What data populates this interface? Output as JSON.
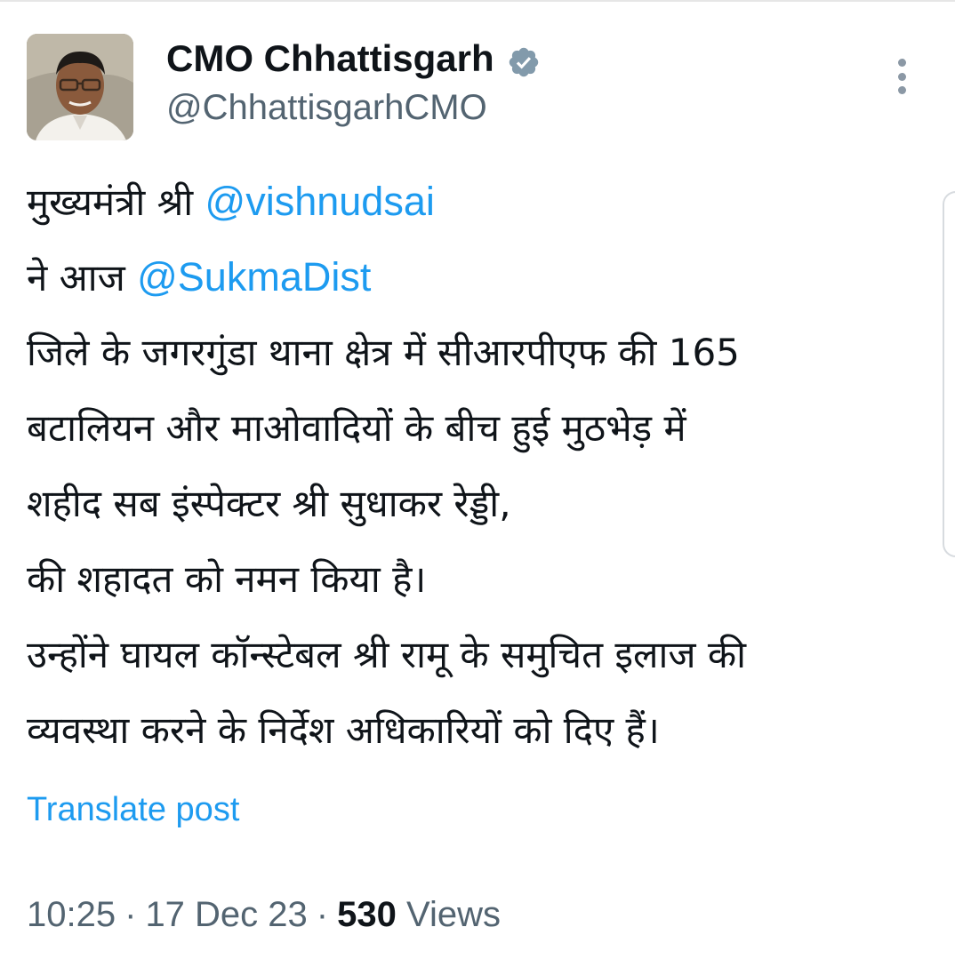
{
  "author": {
    "display_name": "CMO Chhattisgarh",
    "handle": "@ChhattisgarhCMO",
    "verified": true,
    "avatar_icon": "profile-photo"
  },
  "tweet": {
    "line1_text": "मुख्यमंत्री श्री ",
    "mention1": "@vishnudsai",
    "line2_text": "ने आज ",
    "mention2": "@SukmaDist",
    "line3": "जिले के जगरगुंडा थाना क्षेत्र में सीआरपीएफ की 165",
    "line4": "बटालियन और माओवादियों के बीच हुई मुठभेड़ में",
    "line5": "शहीद सब इंस्पेक्टर श्री सुधाकर रेड्डी,",
    "line6": "की शहादत को नमन किया है।",
    "line7": "उन्होंने घायल कॉन्स्टेबल श्री रामू के समुचित इलाज की",
    "line8": "व्यवस्था करने के निर्देश अधिकारियों को दिए हैं।"
  },
  "translate_label": "Translate post",
  "meta": {
    "time": "10:25",
    "separator": "·",
    "date": "17 Dec 23",
    "views_count": "530",
    "views_label": "Views"
  },
  "colors": {
    "link": "#1d9bf0",
    "secondary_text": "#536471",
    "primary_text": "#0f1419",
    "verified_badge": "#829aab"
  },
  "icons": {
    "verified": "verified-badge-icon",
    "more": "more-vertical-icon"
  }
}
